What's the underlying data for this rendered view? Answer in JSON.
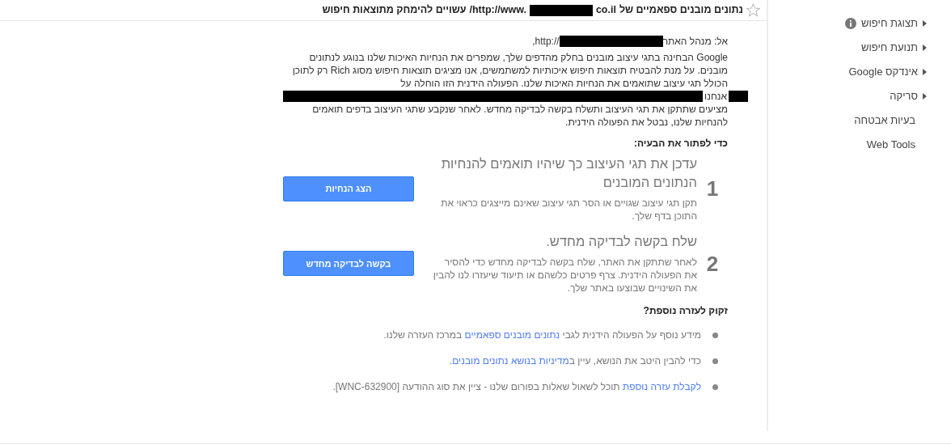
{
  "header": {
    "starred": false,
    "title_parts": [
      {
        "kind": "text",
        "text": "נתונים מובנים ספאמיים של"
      },
      {
        "kind": "text",
        "text": "co.il"
      },
      {
        "kind": "redacted"
      },
      {
        "kind": "text",
        "text": "/http://www."
      },
      {
        "kind": "text",
        "text": "עשויים להימחק מתוצאות חיפוש"
      }
    ]
  },
  "sidebar": {
    "items": [
      {
        "label": "תצוגת חיפוש",
        "expandable": true,
        "info": true
      },
      {
        "label": "תנועת חיפוש",
        "expandable": true,
        "info": false
      },
      {
        "label": "אינדקס Google",
        "expandable": true,
        "info": false
      },
      {
        "label": "סריקה",
        "expandable": true,
        "info": false
      },
      {
        "label": "בעיות אבטחה",
        "expandable": false,
        "info": false
      },
      {
        "label": "Web Tools",
        "expandable": false,
        "info": false
      }
    ]
  },
  "message": {
    "to_parts": [
      {
        "kind": "text",
        "text": "אל: מנהל האתר"
      },
      {
        "kind": "redacted"
      },
      {
        "kind": "text",
        "text": ",http://"
      }
    ],
    "body_1": "Google הבחינה בתגי עיצוב מובנים בחלק מהדפים שלך, שמפרים את הנחיות האיכות שלנו בנוגע לנתונים מובנים. על מנת להבטיח תוצאות חיפוש איכותיות למשתמשים, אנו מציגים תוצאות חיפוש מסוג Rich רק לתוכן הכולל תגי עיצוב שתואמים את הנחיות האיכות שלנו. הפעולה הידנית הזו הוחלה על",
    "redacted_line_word": "אנחנו",
    "body_2": "מציעים שתתקן את תגי העיצוב ותשלח בקשה לבדיקה מחדש. לאחר שנקבע שתגי העיצוב בדפים תואמים להנחיות שלנו, נבטל את הפעולה הידנית."
  },
  "fix": {
    "heading": "כדי לפתור את הבעיה:",
    "steps": [
      {
        "number": "1",
        "title": "עדכן את תגי העיצוב כך שיהיו תואמים להנחיות הנתונים המובנים",
        "description": "תקן תגי עיצוב שגויים או הסר תגי עיצוב שאינם מייצגים כראוי את התוכן בדף שלך.",
        "button": "הצג הנחיות"
      },
      {
        "number": "2",
        "title": "שלח בקשה לבדיקה מחדש.",
        "description": "לאחר שתתקן את האתר, שלח בקשה לבדיקה מחדש כדי להסיר את הפעולה הידנית. צרף פרטים כלשהם או תיעוד שיעזרו לנו להבין את השינויים שבוצעו באתר שלך.",
        "button": "בקשה לבדיקה מחדש"
      }
    ]
  },
  "help": {
    "heading": "זקוק לעזרה נוספת?",
    "items": [
      {
        "segments": [
          {
            "text": "מידע נוסף על הפעולה הידנית לגבי ",
            "link": false
          },
          {
            "text": "נתונים מובנים ספאמיים",
            "link": true
          },
          {
            "text": " במרכז העזרה שלנו.",
            "link": false
          }
        ]
      },
      {
        "segments": [
          {
            "text": "כדי להבין היטב את הנושא, עיין ב",
            "link": false
          },
          {
            "text": "מדיניות בנושא נתונים מובנים",
            "link": true
          },
          {
            "text": ".",
            "link": false
          }
        ]
      },
      {
        "segments": [
          {
            "text": "לקבלת עזרה נוספת",
            "link": true
          },
          {
            "text": " תוכל לשאול שאלות בפורום שלנו - ציין את סוג ההודעה [WNC-632900].",
            "link": false
          }
        ]
      }
    ]
  }
}
